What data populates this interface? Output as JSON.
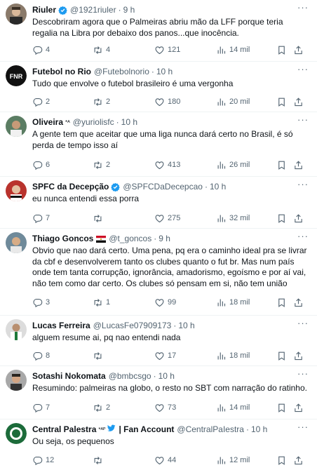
{
  "colors": {
    "accent": "#1d9bf0",
    "muted": "#536471",
    "text": "#0f1419",
    "divider": "#eff3f4"
  },
  "icons": {
    "reply": "reply-icon",
    "retweet": "retweet-icon",
    "like": "heart-icon",
    "views": "views-icon",
    "bookmark": "bookmark-icon",
    "share": "share-icon",
    "more": "more-icon",
    "verified": "verified-badge-icon"
  },
  "tweets": [
    {
      "name": "Riuler",
      "handle": "@1921riuler",
      "time": "9 h",
      "text": "Descobriram agora que o Palmeiras abriu mão da LFF porque teria regalia na Libra por debaixo dos panos...que inocência.",
      "replies": "4",
      "retweets": "4",
      "likes": "121",
      "views": "14 mil"
    },
    {
      "name": "Futebol no Rio",
      "handle": "@Futebolnorio",
      "time": "10 h",
      "text": "Tudo que envolve o futebol brasileiro é uma vergonha",
      "replies": "2",
      "retweets": "2",
      "likes": "180",
      "views": "20 mil"
    },
    {
      "name": "Oliveira",
      "name_badge": "*ᴬ",
      "handle": "@yuriolisfc",
      "time": "10 h",
      "text": "A gente tem que aceitar que uma liga nunca dará certo no Brasil, é só perda de tempo isso aí",
      "replies": "6",
      "retweets": "2",
      "likes": "413",
      "views": "26 mil"
    },
    {
      "name": "SPFC da Decepção",
      "handle": "@SPFCDaDecepcao",
      "time": "10 h",
      "text": "eu nunca entendi essa porra",
      "replies": "7",
      "retweets": "",
      "likes": "275",
      "views": "32 mil"
    },
    {
      "name": "Thiago Goncos",
      "handle": "@t_goncos",
      "time": "9 h",
      "text": "Obvio que nao dará certo. Uma pena, pq era o caminho ideal pra se livrar da cbf e desenvolverem tanto os clubes quanto o fut br. Mas num país onde tem tanta corrupção, ignorância, amadorismo, egoísmo e por aí vai, não tem como dar certo. Os clubes só pensam em si, não tem união",
      "replies": "3",
      "retweets": "1",
      "likes": "99",
      "views": "18 mil"
    },
    {
      "name": "Lucas Ferreira",
      "handle": "@LucasFe07909173",
      "time": "10 h",
      "text": "alguem resume ai, pq nao entendi nada",
      "replies": "8",
      "retweets": "",
      "likes": "17",
      "views": "18 mil"
    },
    {
      "name": "Sotashi Nokomata",
      "handle": "@bmbcsgo",
      "time": "10 h",
      "text": "Resumindo: palmeiras na globo, o resto no SBT com narração do ratinho.",
      "replies": "7",
      "retweets": "2",
      "likes": "73",
      "views": "14 mil"
    },
    {
      "name": "Central Palestra",
      "name_badge": "*ᴬᴾ",
      "name_suffix": "| Fan Account",
      "handle": "@CentralPaIestra",
      "time": "10 h",
      "text": "Ou seja, os pequenos",
      "replies": "12",
      "retweets": "",
      "likes": "44",
      "views": "12 mil"
    }
  ]
}
